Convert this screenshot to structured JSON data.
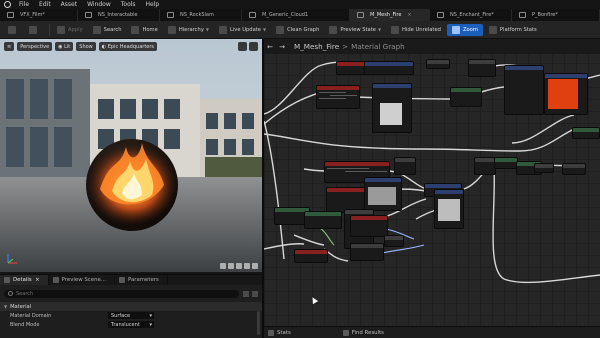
{
  "menu": {
    "items": [
      "File",
      "Edit",
      "Asset",
      "Window",
      "Tools",
      "Help"
    ]
  },
  "tabs": [
    {
      "label": "VFX_Film*",
      "active": false
    },
    {
      "label": "NS_Interactable",
      "active": false
    },
    {
      "label": "NS_RockSlam",
      "active": false
    },
    {
      "label": "M_Generic_Cloud1",
      "active": false
    },
    {
      "label": "M_Mesh_Fire",
      "active": true
    },
    {
      "label": "NS_Enchant_Fire*",
      "active": false
    },
    {
      "label": "P_Bonfire*",
      "active": false
    }
  ],
  "toolbar": {
    "apply": "Apply",
    "search": "Search",
    "home": "Home",
    "hierarchy": "Hierarchy",
    "live_update": "Live Update",
    "clean_graph": "Clean Graph",
    "preview_state": "Preview State",
    "hide_unrelated": "Hide Unrelated",
    "zoom": "Zoom",
    "platform_stats": "Platform Stats"
  },
  "viewport": {
    "perspective": "Perspective",
    "lit": "Lit",
    "show": "Show",
    "environment": "Epic Headquarters"
  },
  "details": {
    "tabs": [
      "Details",
      "Preview Scene...",
      "Parameters"
    ],
    "search_placeholder": "Search",
    "section": "Material",
    "properties": [
      {
        "name": "Material Domain",
        "value": "Surface"
      },
      {
        "name": "Blend Mode",
        "value": "Translucent"
      }
    ]
  },
  "graph": {
    "breadcrumb_asset": "M_Mesh_Fire",
    "breadcrumb_sep": ">",
    "breadcrumb_graph": "Material Graph"
  },
  "status": {
    "stats": "Stats",
    "find_results": "Find Results"
  },
  "colors": {
    "accent": "#1c5fbb",
    "node_header_red": "#8a1f1f",
    "node_header_green": "#2f5a3c",
    "node_header_blue": "#2c3f6e",
    "fire_orange": "#ff7a1a"
  }
}
